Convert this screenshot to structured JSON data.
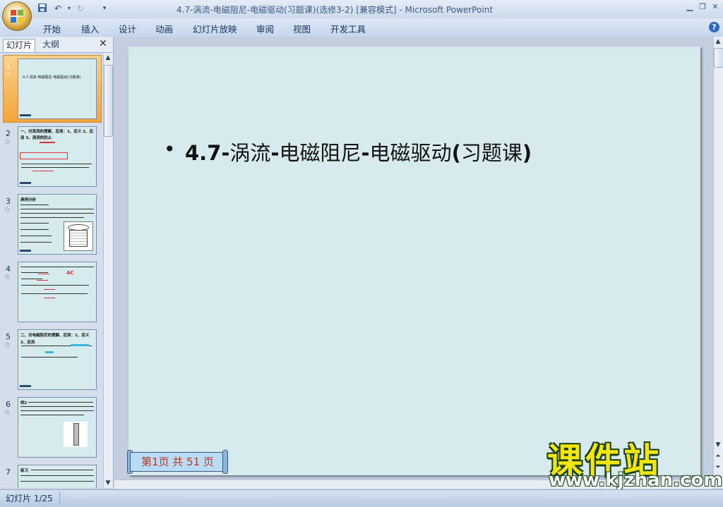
{
  "window": {
    "title": "4.7-涡流-电磁阻尼-电磁驱动(习题课)(选修3-2) [兼容模式] - Microsoft PowerPoint"
  },
  "ribbon": {
    "tabs": [
      "开始",
      "插入",
      "设计",
      "动画",
      "幻灯片放映",
      "审阅",
      "视图",
      "开发工具"
    ]
  },
  "panel": {
    "tab_slides": "幻灯片",
    "tab_outline": "大纲"
  },
  "thumbnails": [
    {
      "num": "1",
      "text": "4.7-涡流-电磁阻尼-电磁驱动(习题课)"
    },
    {
      "num": "2",
      "text": "一、对涡流的理解、应用：1、定义 2、应用 3、涡流的防止"
    },
    {
      "num": "3",
      "text": "典例分析"
    },
    {
      "num": "4",
      "text": "AC"
    },
    {
      "num": "5",
      "text": "二、对电磁阻尼的理解、应用：1、定义 2、应用"
    },
    {
      "num": "6",
      "text": "例2"
    },
    {
      "num": "7",
      "text": "练习"
    }
  ],
  "slide": {
    "bullet": "•",
    "title_prefix": "4.7-",
    "title_part1": "涡流",
    "title_dash1": "-",
    "title_part2": "电磁阻尼",
    "title_dash2": "-",
    "title_part3": "电磁驱动",
    "title_paren_open": "(",
    "title_part4": "习题课",
    "title_paren_close": ")",
    "page_badge": "第1页 共 51 页"
  },
  "watermark": {
    "title": "课件站",
    "url": "www.kjzhan.com"
  },
  "status": {
    "slide_indicator": "幻灯片 1/25"
  }
}
